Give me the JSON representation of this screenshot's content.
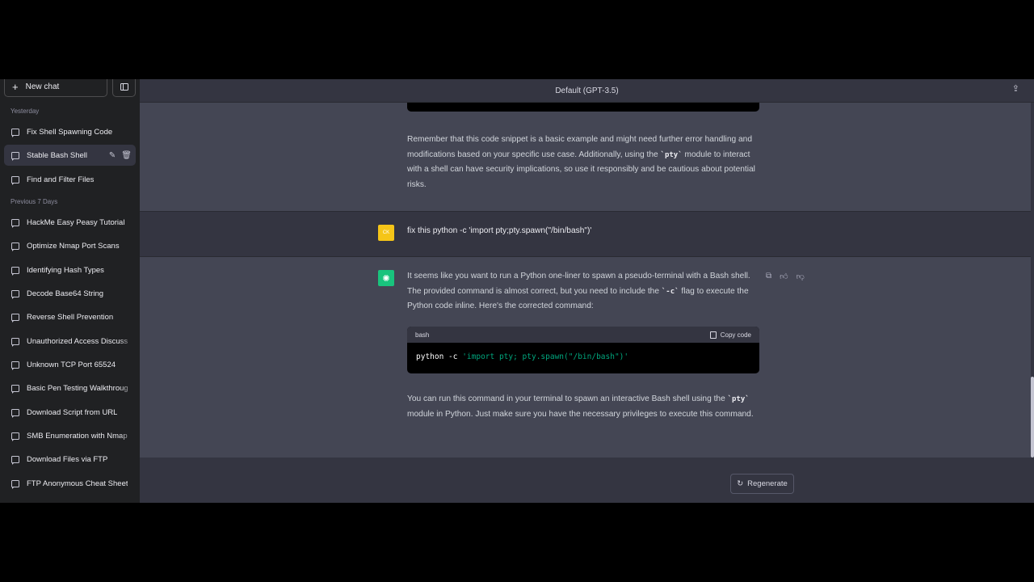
{
  "sidebar": {
    "new_chat": "New chat",
    "sections": {
      "yesterday": "Yesterday",
      "previous": "Previous 7 Days"
    },
    "yesterday_items": [
      {
        "label": "Fix Shell Spawning Code"
      },
      {
        "label": "Stable Bash Shell"
      },
      {
        "label": "Find and Filter Files"
      }
    ],
    "previous_items": [
      {
        "label": "HackMe Easy Peasy Tutorial"
      },
      {
        "label": "Optimize Nmap Port Scans"
      },
      {
        "label": "Identifying Hash Types"
      },
      {
        "label": "Decode Base64 String"
      },
      {
        "label": "Reverse Shell Prevention"
      },
      {
        "label": "Unauthorized Access Discussi"
      },
      {
        "label": "Unknown TCP Port 65524"
      },
      {
        "label": "Basic Pen Testing Walkthroug"
      },
      {
        "label": "Download Script from URL"
      },
      {
        "label": "SMB Enumeration with Nmap"
      },
      {
        "label": "Download Files via FTP"
      },
      {
        "label": "FTP Anonymous Cheat Sheet"
      }
    ]
  },
  "header": {
    "title": "Default (GPT-3.5)"
  },
  "prev_answer": {
    "text_1": "Remember that this code snippet is a basic example and might need further error handling and modifications based on your specific use case. Additionally, using the ",
    "code_1": "`pty`",
    "text_2": " module to interact with a shell can have security implications, so use it responsibly and be cautious about potential risks."
  },
  "user_message": {
    "avatar": "CK",
    "text": "fix this python -c 'import pty;pty.spawn(\"/bin/bash\")'"
  },
  "assistant": {
    "p1_a": "It seems like you want to run a Python one-liner to spawn a pseudo-terminal with a Bash shell. The provided command is almost correct, but you need to include the ",
    "p1_code": "`-c`",
    "p1_b": " flag to execute the Python code inline. Here's the corrected command:",
    "code_lang": "bash",
    "copy_label": "Copy code",
    "code_cmd": "python -c ",
    "code_str": "'import pty; pty.spawn(\"/bin/bash\")'",
    "p2_a": "You can run this command in your terminal to spawn an interactive Bash shell using the ",
    "p2_code": "`pty`",
    "p2_b": " module in Python. Just make sure you have the necessary privileges to execute this command."
  },
  "regenerate_label": "Regenerate",
  "colors": {
    "sidebar_bg": "#202123",
    "main_bg": "#343541",
    "assistant_bg": "#444654",
    "accent_green": "#19c37d",
    "user_avatar": "#f5c518"
  }
}
